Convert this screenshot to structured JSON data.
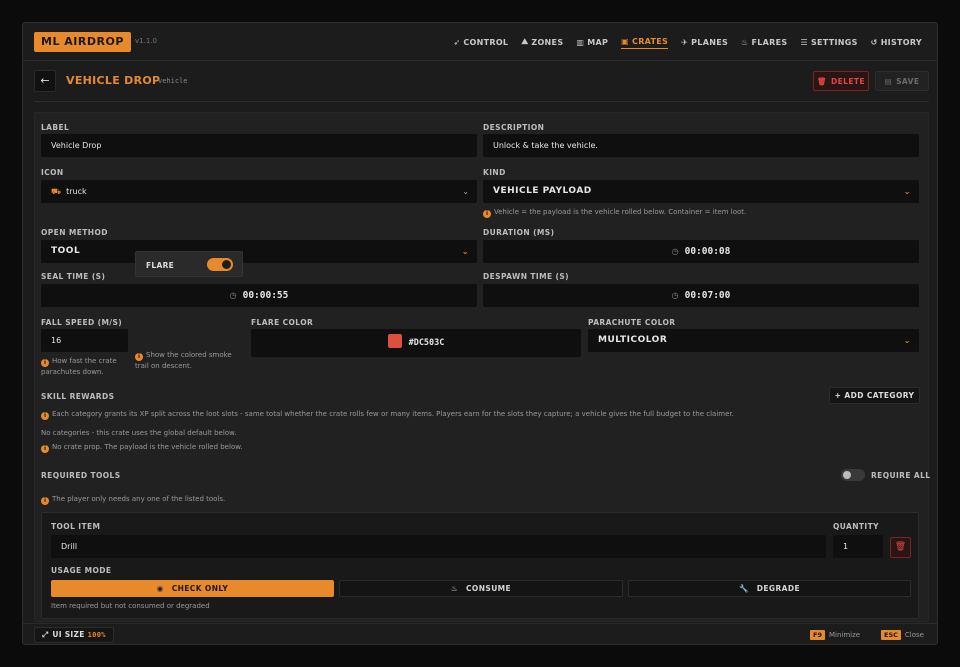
{
  "app": {
    "brand": "ML AIRDROP",
    "version": "v1.1.0"
  },
  "nav": [
    {
      "label": "CONTROL",
      "icon": "rocket-icon",
      "glyph": "➶"
    },
    {
      "label": "ZONES",
      "icon": "zones-icon",
      "glyph": "⛰"
    },
    {
      "label": "MAP",
      "icon": "map-icon",
      "glyph": "▥"
    },
    {
      "label": "CRATES",
      "icon": "crate-icon",
      "glyph": "▣",
      "active": true
    },
    {
      "label": "PLANES",
      "icon": "plane-icon",
      "glyph": "✈"
    },
    {
      "label": "FLARES",
      "icon": "flame-icon",
      "glyph": "♨"
    },
    {
      "label": "SETTINGS",
      "icon": "sliders-icon",
      "glyph": "☰"
    },
    {
      "label": "HISTORY",
      "icon": "history-icon",
      "glyph": "↺"
    }
  ],
  "header": {
    "title": "VEHICLE DROP",
    "slug": "vehicle",
    "delete_label": "DELETE",
    "save_label": "SAVE"
  },
  "form": {
    "label": {
      "label": "LABEL",
      "value": "Vehicle Drop"
    },
    "description": {
      "label": "DESCRIPTION",
      "value": "Unlock & take the vehicle."
    },
    "icon": {
      "label": "ICON",
      "value": "truck"
    },
    "kind": {
      "label": "KIND",
      "value": "VEHICLE PAYLOAD",
      "hint": "Vehicle = the payload is the vehicle rolled below. Container = item loot."
    },
    "open_method": {
      "label": "OPEN METHOD",
      "value": "TOOL"
    },
    "duration": {
      "label": "DURATION (MS)",
      "value": "00:00:08"
    },
    "seal_time": {
      "label": "SEAL TIME (S)",
      "value": "00:00:55"
    },
    "despawn_time": {
      "label": "DESPAWN TIME (S)",
      "value": "00:07:00"
    },
    "fall_speed": {
      "label": "FALL SPEED (M/S)",
      "value": "16",
      "hint": "How fast the crate parachutes down."
    },
    "flare": {
      "label": "FLARE",
      "enabled": true,
      "hint": "Show the colored smoke trail on descent."
    },
    "flare_color": {
      "label": "FLARE COLOR",
      "value": "#DC503C",
      "color": "#DC503C"
    },
    "parachute_color": {
      "label": "PARACHUTE COLOR",
      "value": "MULTICOLOR"
    }
  },
  "skill_rewards": {
    "title": "SKILL REWARDS",
    "add_label": "+ ADD CATEGORY",
    "info": "Each category grants its XP split across the loot slots - same total whether the crate rolls few or many items. Players earn for the slots they capture; a vehicle gives the full budget to the claimer.",
    "empty": "No categories - this crate uses the global default below.",
    "no_prop": "No crate prop. The payload is the vehicle rolled below."
  },
  "required_tools": {
    "title": "REQUIRED TOOLS",
    "require_all_label": "REQUIRE ALL",
    "require_all": false,
    "info": "The player only needs any one of the listed tools.",
    "item": {
      "tool_label": "TOOL ITEM",
      "tool_value": "Drill",
      "quantity_label": "QUANTITY",
      "quantity_value": "1",
      "usage_label": "USAGE MODE",
      "modes": [
        "CHECK ONLY",
        "CONSUME",
        "DEGRADE"
      ],
      "active_mode": "CHECK ONLY",
      "mode_hint": "Item required but not consumed or degraded"
    }
  },
  "footer": {
    "ui_size_label": "UI SIZE",
    "ui_size_value": "100%",
    "minimize_key": "F9",
    "minimize_label": "Minimize",
    "close_key": "ESC",
    "close_label": "Close"
  },
  "colors": {
    "accent": "#e88a2c",
    "danger": "#e04848",
    "background": "#1c1c1c"
  }
}
